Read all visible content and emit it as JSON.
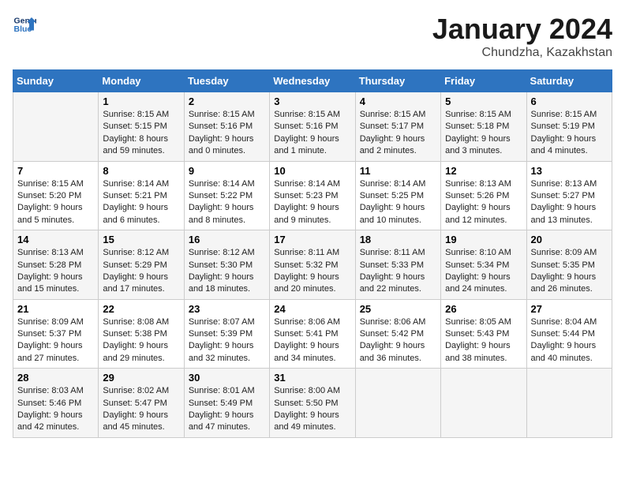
{
  "header": {
    "logo_line1": "General",
    "logo_line2": "Blue",
    "month": "January 2024",
    "location": "Chundzha, Kazakhstan"
  },
  "weekdays": [
    "Sunday",
    "Monday",
    "Tuesday",
    "Wednesday",
    "Thursday",
    "Friday",
    "Saturday"
  ],
  "weeks": [
    [
      {
        "day": "",
        "sunrise": "",
        "sunset": "",
        "daylight": ""
      },
      {
        "day": "1",
        "sunrise": "Sunrise: 8:15 AM",
        "sunset": "Sunset: 5:15 PM",
        "daylight": "Daylight: 8 hours and 59 minutes."
      },
      {
        "day": "2",
        "sunrise": "Sunrise: 8:15 AM",
        "sunset": "Sunset: 5:16 PM",
        "daylight": "Daylight: 9 hours and 0 minutes."
      },
      {
        "day": "3",
        "sunrise": "Sunrise: 8:15 AM",
        "sunset": "Sunset: 5:16 PM",
        "daylight": "Daylight: 9 hours and 1 minute."
      },
      {
        "day": "4",
        "sunrise": "Sunrise: 8:15 AM",
        "sunset": "Sunset: 5:17 PM",
        "daylight": "Daylight: 9 hours and 2 minutes."
      },
      {
        "day": "5",
        "sunrise": "Sunrise: 8:15 AM",
        "sunset": "Sunset: 5:18 PM",
        "daylight": "Daylight: 9 hours and 3 minutes."
      },
      {
        "day": "6",
        "sunrise": "Sunrise: 8:15 AM",
        "sunset": "Sunset: 5:19 PM",
        "daylight": "Daylight: 9 hours and 4 minutes."
      }
    ],
    [
      {
        "day": "7",
        "sunrise": "Sunrise: 8:15 AM",
        "sunset": "Sunset: 5:20 PM",
        "daylight": "Daylight: 9 hours and 5 minutes."
      },
      {
        "day": "8",
        "sunrise": "Sunrise: 8:14 AM",
        "sunset": "Sunset: 5:21 PM",
        "daylight": "Daylight: 9 hours and 6 minutes."
      },
      {
        "day": "9",
        "sunrise": "Sunrise: 8:14 AM",
        "sunset": "Sunset: 5:22 PM",
        "daylight": "Daylight: 9 hours and 8 minutes."
      },
      {
        "day": "10",
        "sunrise": "Sunrise: 8:14 AM",
        "sunset": "Sunset: 5:23 PM",
        "daylight": "Daylight: 9 hours and 9 minutes."
      },
      {
        "day": "11",
        "sunrise": "Sunrise: 8:14 AM",
        "sunset": "Sunset: 5:25 PM",
        "daylight": "Daylight: 9 hours and 10 minutes."
      },
      {
        "day": "12",
        "sunrise": "Sunrise: 8:13 AM",
        "sunset": "Sunset: 5:26 PM",
        "daylight": "Daylight: 9 hours and 12 minutes."
      },
      {
        "day": "13",
        "sunrise": "Sunrise: 8:13 AM",
        "sunset": "Sunset: 5:27 PM",
        "daylight": "Daylight: 9 hours and 13 minutes."
      }
    ],
    [
      {
        "day": "14",
        "sunrise": "Sunrise: 8:13 AM",
        "sunset": "Sunset: 5:28 PM",
        "daylight": "Daylight: 9 hours and 15 minutes."
      },
      {
        "day": "15",
        "sunrise": "Sunrise: 8:12 AM",
        "sunset": "Sunset: 5:29 PM",
        "daylight": "Daylight: 9 hours and 17 minutes."
      },
      {
        "day": "16",
        "sunrise": "Sunrise: 8:12 AM",
        "sunset": "Sunset: 5:30 PM",
        "daylight": "Daylight: 9 hours and 18 minutes."
      },
      {
        "day": "17",
        "sunrise": "Sunrise: 8:11 AM",
        "sunset": "Sunset: 5:32 PM",
        "daylight": "Daylight: 9 hours and 20 minutes."
      },
      {
        "day": "18",
        "sunrise": "Sunrise: 8:11 AM",
        "sunset": "Sunset: 5:33 PM",
        "daylight": "Daylight: 9 hours and 22 minutes."
      },
      {
        "day": "19",
        "sunrise": "Sunrise: 8:10 AM",
        "sunset": "Sunset: 5:34 PM",
        "daylight": "Daylight: 9 hours and 24 minutes."
      },
      {
        "day": "20",
        "sunrise": "Sunrise: 8:09 AM",
        "sunset": "Sunset: 5:35 PM",
        "daylight": "Daylight: 9 hours and 26 minutes."
      }
    ],
    [
      {
        "day": "21",
        "sunrise": "Sunrise: 8:09 AM",
        "sunset": "Sunset: 5:37 PM",
        "daylight": "Daylight: 9 hours and 27 minutes."
      },
      {
        "day": "22",
        "sunrise": "Sunrise: 8:08 AM",
        "sunset": "Sunset: 5:38 PM",
        "daylight": "Daylight: 9 hours and 29 minutes."
      },
      {
        "day": "23",
        "sunrise": "Sunrise: 8:07 AM",
        "sunset": "Sunset: 5:39 PM",
        "daylight": "Daylight: 9 hours and 32 minutes."
      },
      {
        "day": "24",
        "sunrise": "Sunrise: 8:06 AM",
        "sunset": "Sunset: 5:41 PM",
        "daylight": "Daylight: 9 hours and 34 minutes."
      },
      {
        "day": "25",
        "sunrise": "Sunrise: 8:06 AM",
        "sunset": "Sunset: 5:42 PM",
        "daylight": "Daylight: 9 hours and 36 minutes."
      },
      {
        "day": "26",
        "sunrise": "Sunrise: 8:05 AM",
        "sunset": "Sunset: 5:43 PM",
        "daylight": "Daylight: 9 hours and 38 minutes."
      },
      {
        "day": "27",
        "sunrise": "Sunrise: 8:04 AM",
        "sunset": "Sunset: 5:44 PM",
        "daylight": "Daylight: 9 hours and 40 minutes."
      }
    ],
    [
      {
        "day": "28",
        "sunrise": "Sunrise: 8:03 AM",
        "sunset": "Sunset: 5:46 PM",
        "daylight": "Daylight: 9 hours and 42 minutes."
      },
      {
        "day": "29",
        "sunrise": "Sunrise: 8:02 AM",
        "sunset": "Sunset: 5:47 PM",
        "daylight": "Daylight: 9 hours and 45 minutes."
      },
      {
        "day": "30",
        "sunrise": "Sunrise: 8:01 AM",
        "sunset": "Sunset: 5:49 PM",
        "daylight": "Daylight: 9 hours and 47 minutes."
      },
      {
        "day": "31",
        "sunrise": "Sunrise: 8:00 AM",
        "sunset": "Sunset: 5:50 PM",
        "daylight": "Daylight: 9 hours and 49 minutes."
      },
      {
        "day": "",
        "sunrise": "",
        "sunset": "",
        "daylight": ""
      },
      {
        "day": "",
        "sunrise": "",
        "sunset": "",
        "daylight": ""
      },
      {
        "day": "",
        "sunrise": "",
        "sunset": "",
        "daylight": ""
      }
    ]
  ]
}
